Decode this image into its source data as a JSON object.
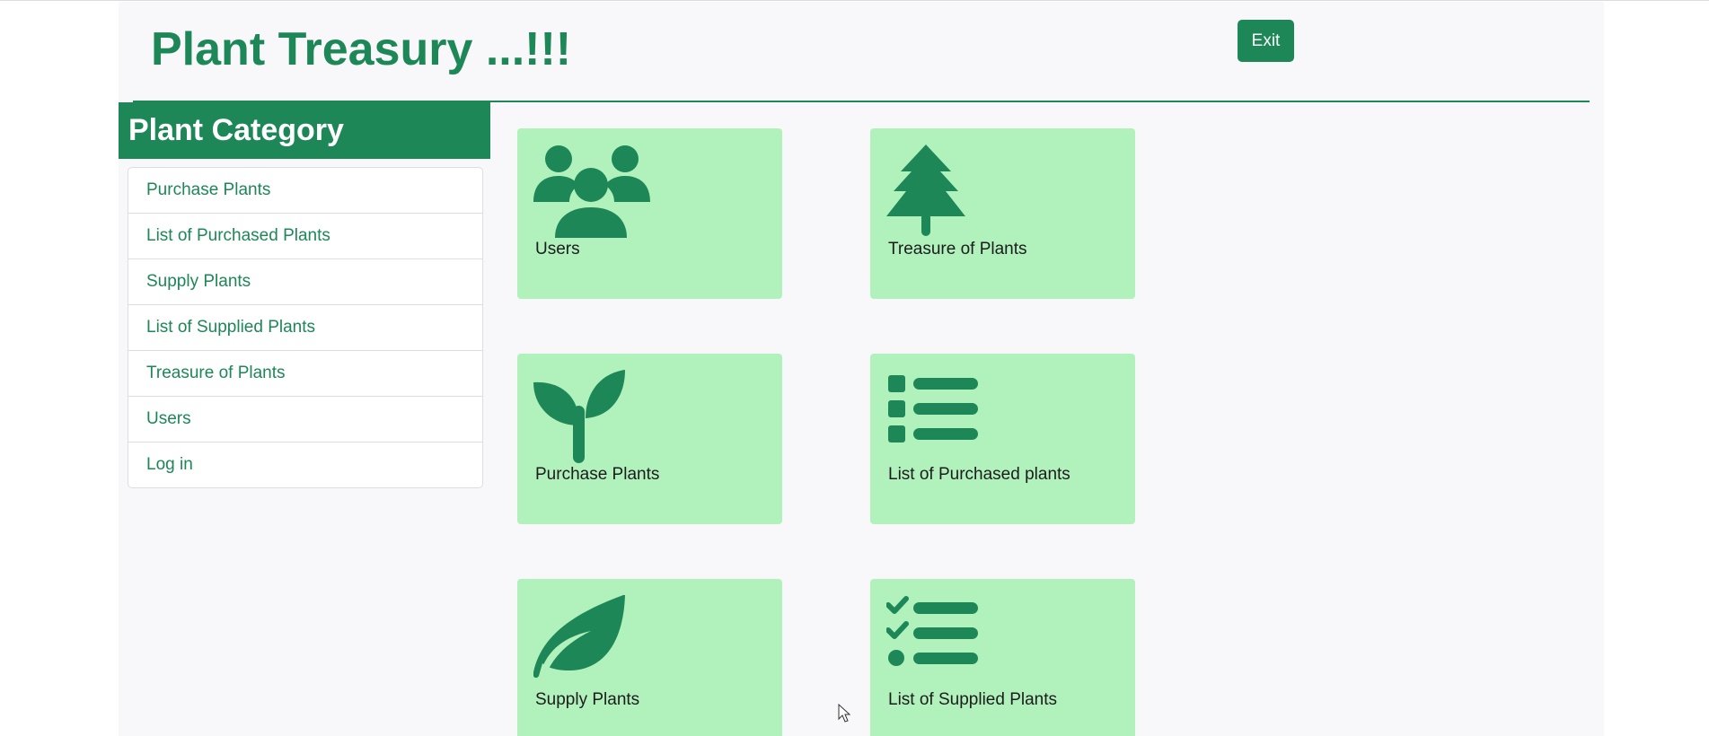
{
  "header": {
    "title": "Plant Treasury ...!!!",
    "exit_label": "Exit"
  },
  "sidebar": {
    "title": "Plant Category",
    "items": [
      {
        "label": "Purchase Plants"
      },
      {
        "label": "List of Purchased Plants"
      },
      {
        "label": "Supply Plants"
      },
      {
        "label": "List of Supplied Plants"
      },
      {
        "label": "Treasure of Plants"
      },
      {
        "label": "Users"
      },
      {
        "label": "Log in"
      }
    ]
  },
  "cards": [
    {
      "label": "Users",
      "icon": "users-icon"
    },
    {
      "label": "Treasure of Plants",
      "icon": "tree-icon"
    },
    {
      "label": "Purchase Plants",
      "icon": "seedling-icon"
    },
    {
      "label": "List of Purchased plants",
      "icon": "list-icon"
    },
    {
      "label": "Supply Plants",
      "icon": "leaf-icon"
    },
    {
      "label": "List of Supplied Plants",
      "icon": "checklist-icon"
    }
  ],
  "colors": {
    "primary": "#1d8757",
    "card_background": "#b1f2bc",
    "page_background": "#f8f8fa"
  }
}
